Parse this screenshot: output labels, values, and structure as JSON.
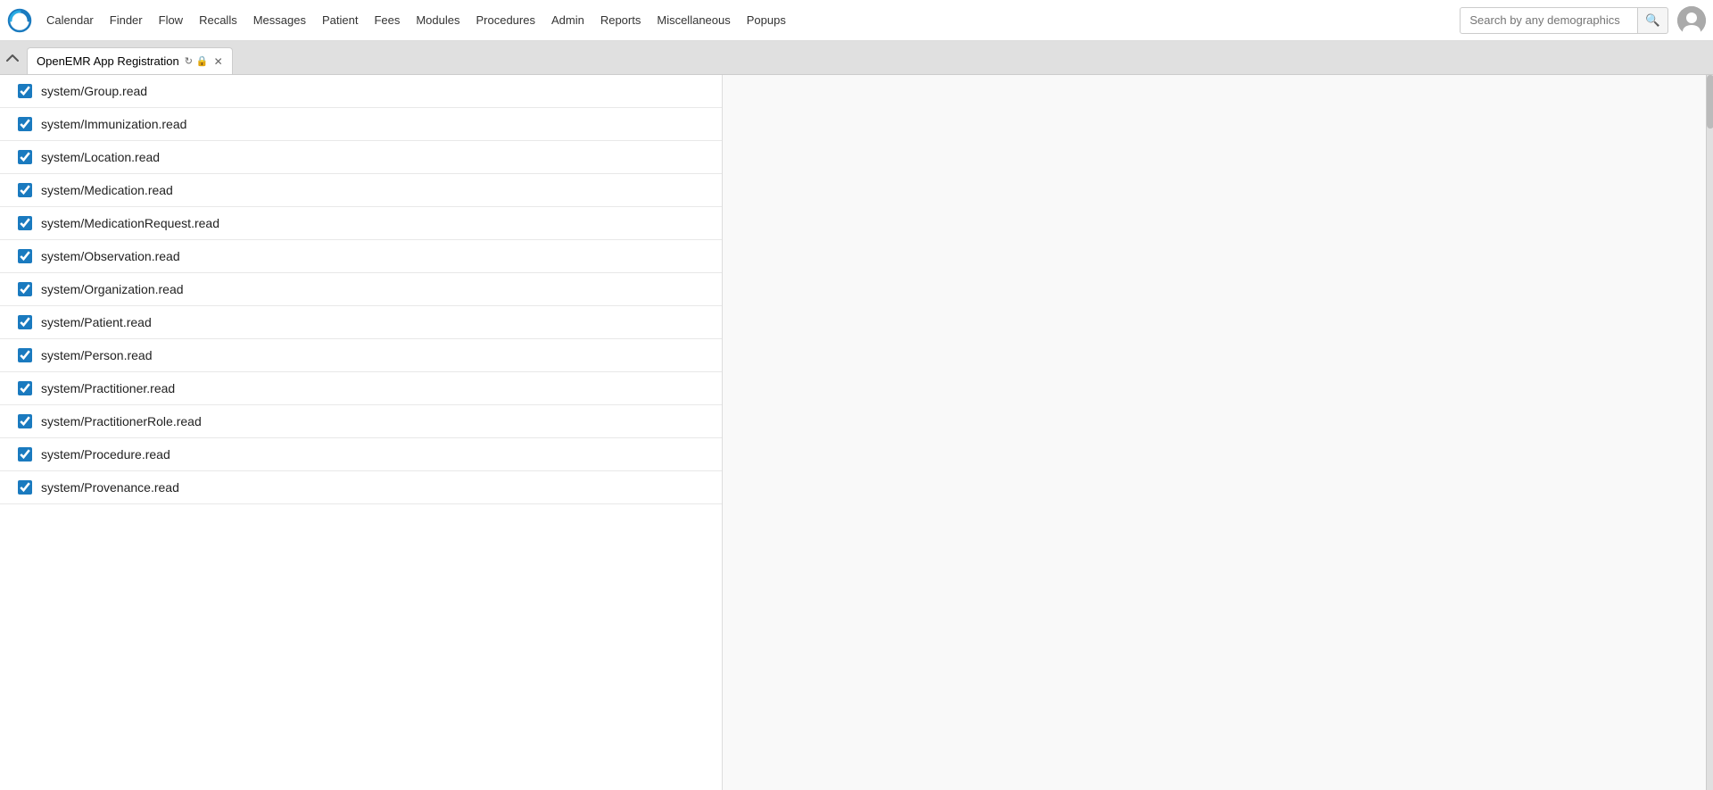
{
  "topbar": {
    "nav_items": [
      "Calendar",
      "Finder",
      "Flow",
      "Recalls",
      "Messages",
      "Patient",
      "Fees",
      "Modules",
      "Procedures",
      "Admin",
      "Reports",
      "Miscellaneous",
      "Popups"
    ],
    "search_placeholder": "Search by any demographics",
    "search_value": ""
  },
  "tab": {
    "title": "OpenEMR App Registration",
    "refresh_icon": "↻",
    "lock_icon": "🔒",
    "close_icon": "✕"
  },
  "checkboxes": [
    {
      "id": "cb1",
      "label": "system/Group.read",
      "checked": true
    },
    {
      "id": "cb2",
      "label": "system/Immunization.read",
      "checked": true
    },
    {
      "id": "cb3",
      "label": "system/Location.read",
      "checked": true
    },
    {
      "id": "cb4",
      "label": "system/Medication.read",
      "checked": true
    },
    {
      "id": "cb5",
      "label": "system/MedicationRequest.read",
      "checked": true
    },
    {
      "id": "cb6",
      "label": "system/Observation.read",
      "checked": true
    },
    {
      "id": "cb7",
      "label": "system/Organization.read",
      "checked": true
    },
    {
      "id": "cb8",
      "label": "system/Patient.read",
      "checked": true
    },
    {
      "id": "cb9",
      "label": "system/Person.read",
      "checked": true
    },
    {
      "id": "cb10",
      "label": "system/Practitioner.read",
      "checked": true
    },
    {
      "id": "cb11",
      "label": "system/PractitionerRole.read",
      "checked": true
    },
    {
      "id": "cb12",
      "label": "system/Procedure.read",
      "checked": true
    },
    {
      "id": "cb13",
      "label": "system/Provenance.read",
      "checked": true
    }
  ],
  "icons": {
    "search": "🔍",
    "user": "👤",
    "minimize": "▲",
    "refresh": "↻",
    "lock": "🔒",
    "close": "✕"
  }
}
